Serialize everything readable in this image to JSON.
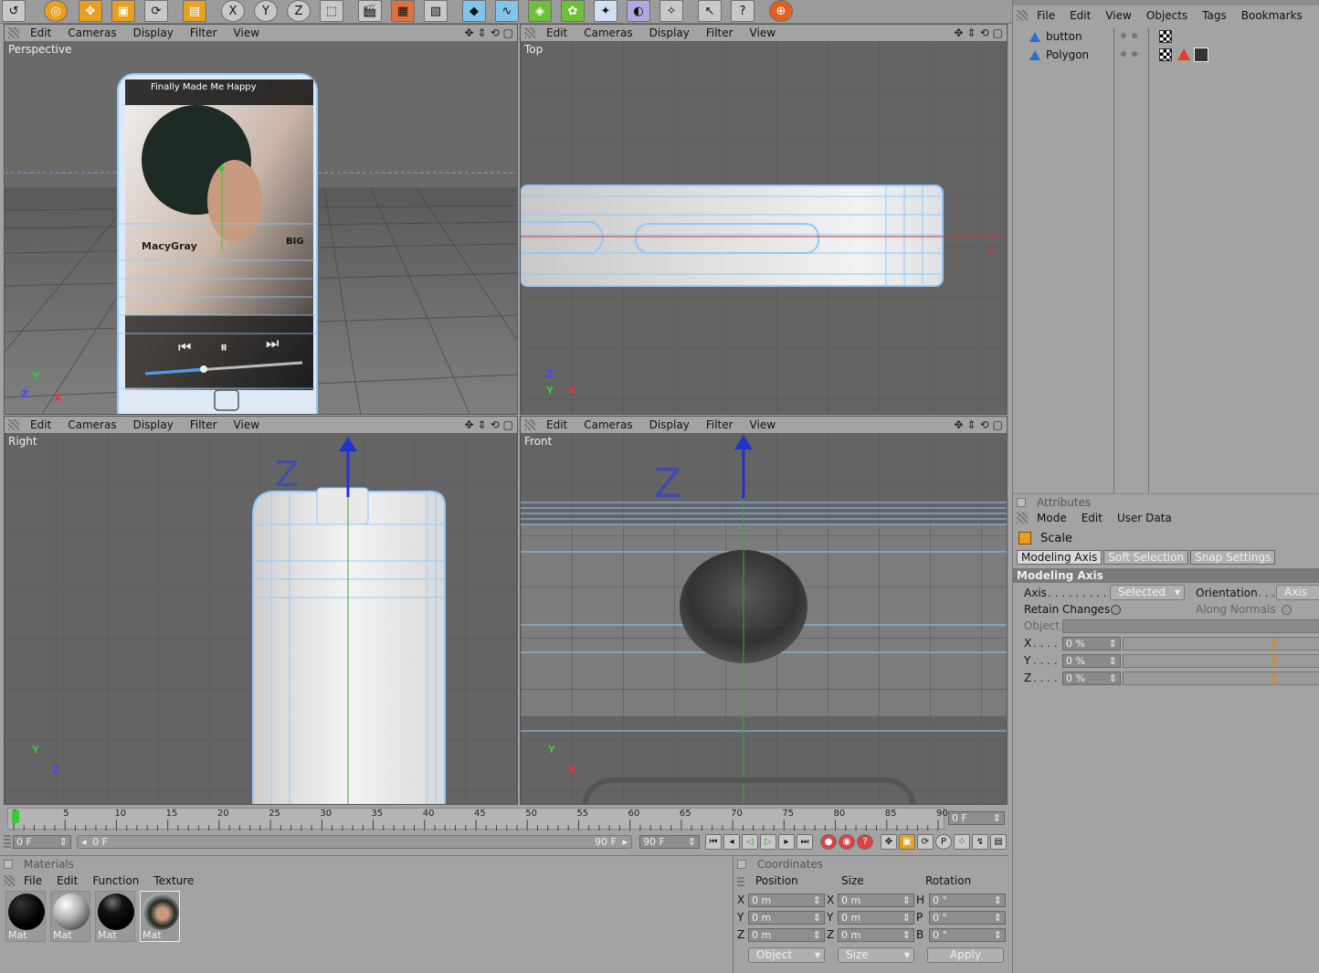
{
  "viewport_menu": [
    "Edit",
    "Cameras",
    "Display",
    "Filter",
    "View"
  ],
  "viewports": {
    "perspective": {
      "label": "Perspective"
    },
    "top": {
      "label": "Top"
    },
    "right": {
      "label": "Right"
    },
    "front": {
      "label": "Front"
    }
  },
  "phone_screen": {
    "song": "Finally Made Me Happy",
    "artist": "MacyGray",
    "badge": "BIG"
  },
  "object_manager": {
    "menu": [
      "File",
      "Edit",
      "View",
      "Objects",
      "Tags",
      "Bookmarks"
    ],
    "objects": [
      {
        "name": "button"
      },
      {
        "name": "Polygon"
      }
    ]
  },
  "attributes": {
    "title": "Attributes",
    "menu": [
      "Mode",
      "Edit",
      "User Data"
    ],
    "tool_name": "Scale",
    "tabs": [
      "Modeling Axis",
      "Soft Selection",
      "Snap Settings"
    ],
    "section": "Modeling Axis",
    "axis_label": "Axis",
    "axis_value": "Selected",
    "orientation_label": "Orientation",
    "orientation_value": "Axis",
    "retain_changes": "Retain Changes",
    "along_normals": "Along Normals",
    "object_label": "Object",
    "x_label": "X",
    "y_label": "Y",
    "z_label": "Z",
    "x_value": "0 %",
    "y_value": "0 %",
    "z_value": "0 %"
  },
  "timeline": {
    "ticks": [
      "0",
      "5",
      "10",
      "15",
      "20",
      "25",
      "30",
      "35",
      "40",
      "45",
      "50",
      "55",
      "60",
      "65",
      "70",
      "75",
      "80",
      "85",
      "90"
    ],
    "current_frame": "0 F",
    "start_frame": "0 F",
    "range_start": "0 F",
    "range_end": "90 F",
    "end_frame": "90 F"
  },
  "materials": {
    "title": "Materials",
    "menu": [
      "File",
      "Edit",
      "Function",
      "Texture"
    ],
    "items": [
      "Mat",
      "Mat",
      "Mat",
      "Mat"
    ]
  },
  "coordinates": {
    "title": "Coordinates",
    "headers": [
      "Position",
      "Size",
      "Rotation"
    ],
    "pos_labels": [
      "X",
      "Y",
      "Z"
    ],
    "size_labels": [
      "X",
      "Y",
      "Z"
    ],
    "rot_labels": [
      "H",
      "P",
      "B"
    ],
    "pos_values": [
      "0 m",
      "0 m",
      "0 m"
    ],
    "size_values": [
      "0 m",
      "0 m",
      "0 m"
    ],
    "rot_values": [
      "0 °",
      "0 °",
      "0 °"
    ],
    "mode": "Object",
    "size_mode": "Size",
    "apply": "Apply"
  },
  "colors": {
    "accent_orange": "#e8a020",
    "wire_blue": "#8ec8ff",
    "viewport_bg": "#646464",
    "panel_bg": "#a3a3a3"
  }
}
